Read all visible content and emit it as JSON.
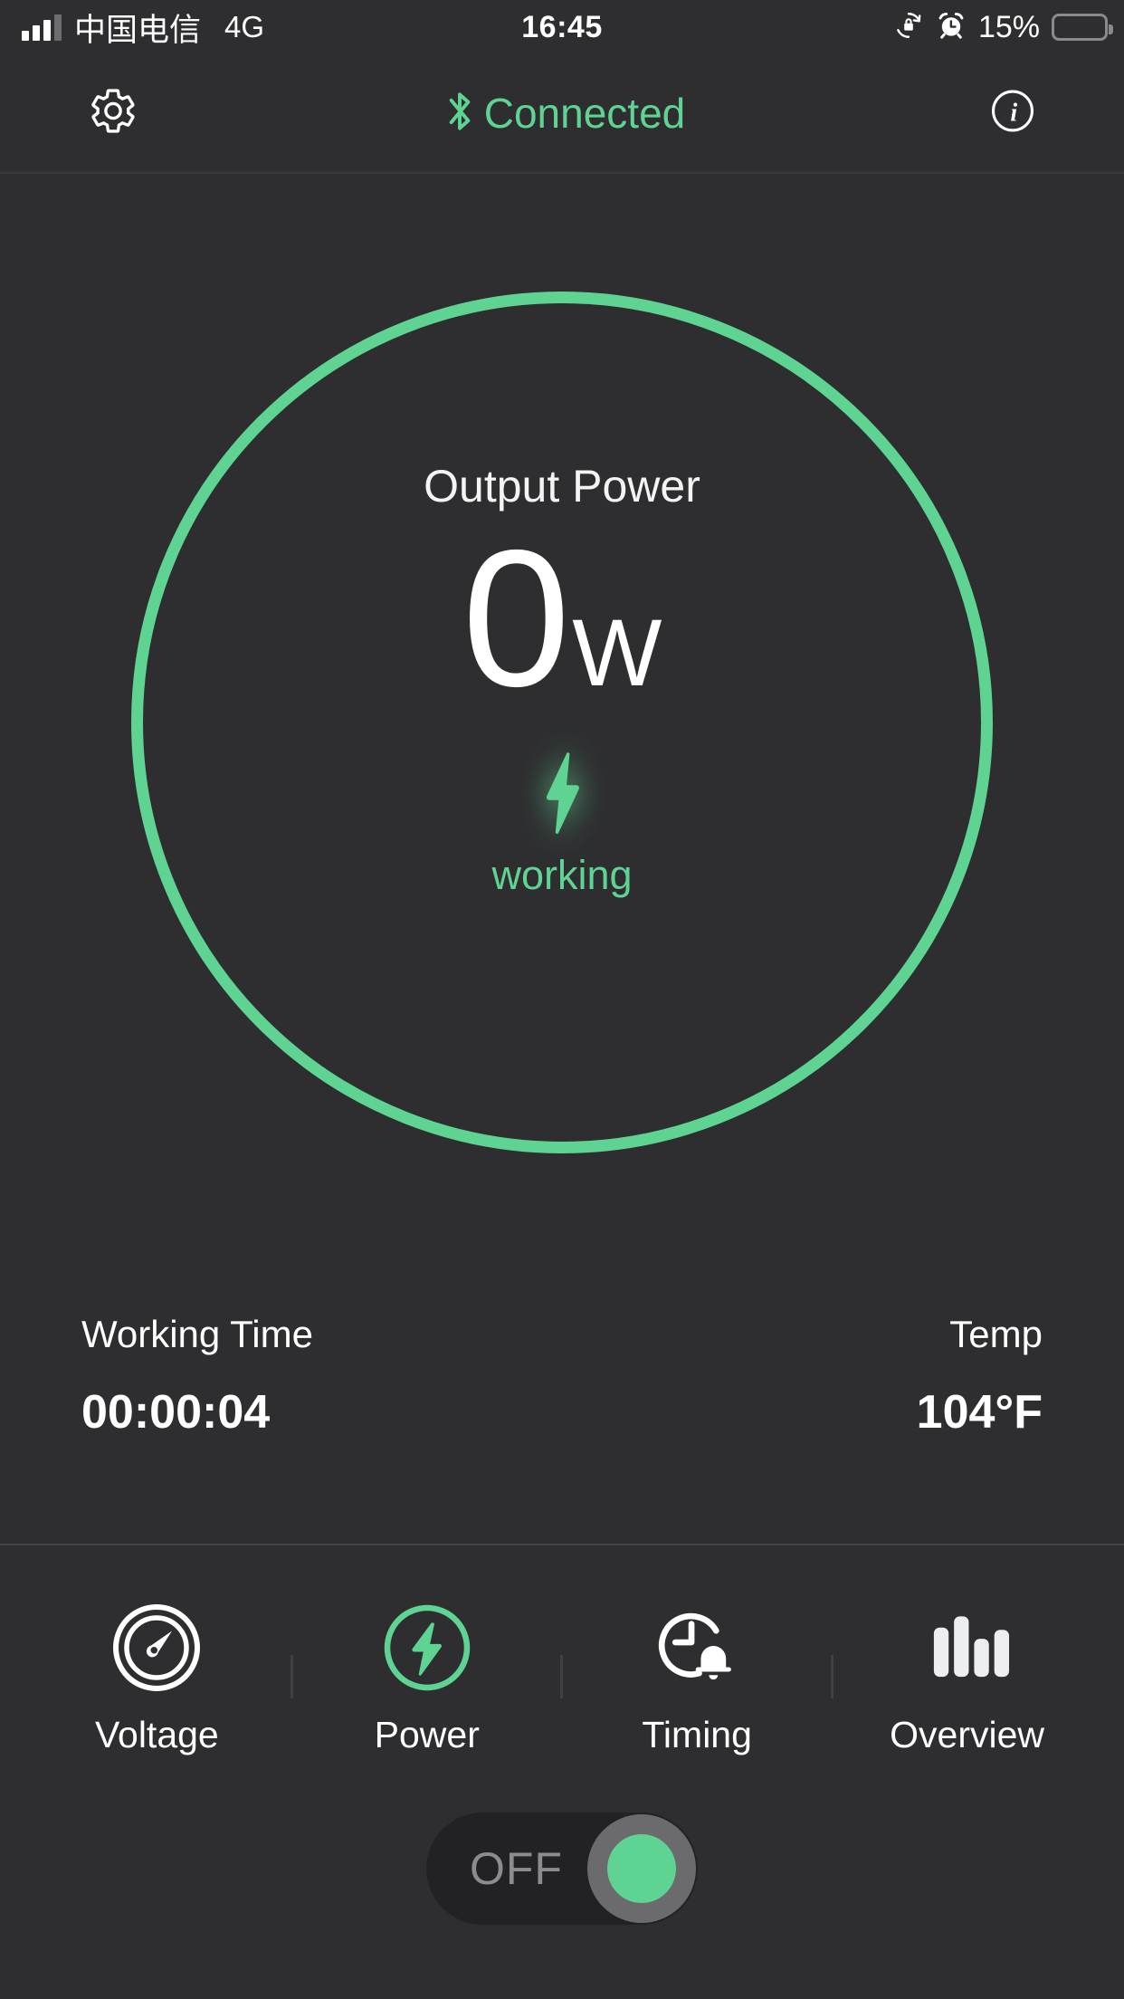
{
  "status_bar": {
    "carrier": "中国电信",
    "network": "4G",
    "time": "16:45",
    "battery_percent": "15%",
    "battery_level": 15,
    "signal_bars_active": 3,
    "signal_bars_total": 4,
    "icons": [
      "rotation-lock-icon",
      "alarm-clock-icon",
      "battery-icon"
    ]
  },
  "header": {
    "settings_icon": "gear-icon",
    "connection_icon": "bluetooth-icon",
    "connection_label": "Connected",
    "info_icon": "info-icon"
  },
  "dial": {
    "title": "Output Power",
    "value": "0",
    "unit": "W",
    "state_icon": "lightning-bolt-icon",
    "state_label": "working"
  },
  "stats": {
    "working_time": {
      "label": "Working Time",
      "value": "00:00:04"
    },
    "temperature": {
      "label": "Temp",
      "value": "104°F"
    }
  },
  "tabs": [
    {
      "label": "Voltage",
      "icon": "gauge-icon",
      "active": false
    },
    {
      "label": "Power",
      "icon": "bolt-circle-icon",
      "active": true
    },
    {
      "label": "Timing",
      "icon": "clock-alarm-icon",
      "active": false
    },
    {
      "label": "Overview",
      "icon": "bar-chart-icon",
      "active": false
    }
  ],
  "power_toggle": {
    "label": "OFF",
    "state": "off"
  },
  "colors": {
    "background": "#2e2e30",
    "accent_green": "#5ed392",
    "text_primary": "#ffffff",
    "text_muted": "#8c8c90",
    "battery_red": "#f5483b"
  }
}
